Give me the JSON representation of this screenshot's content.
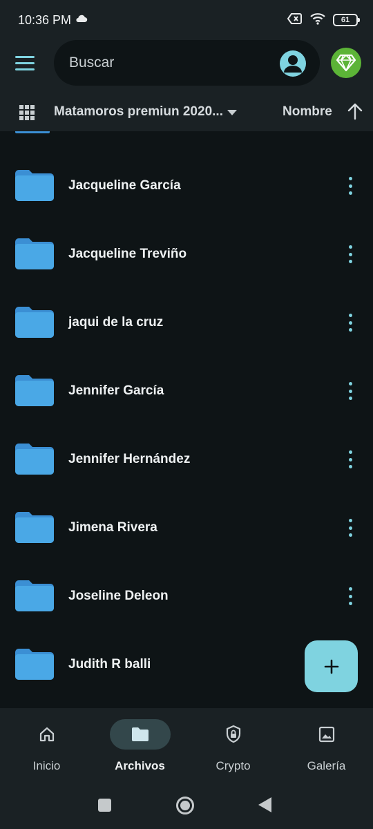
{
  "status_bar": {
    "time": "10:36 PM",
    "battery": "61"
  },
  "header": {
    "search_placeholder": "Buscar",
    "path_label": "Matamoros premiun 2020...",
    "sort_label": "Nombre"
  },
  "folders": [
    {
      "name": "Jacqueline García"
    },
    {
      "name": "Jacqueline Treviño"
    },
    {
      "name": "jaqui de la cruz"
    },
    {
      "name": "Jennifer García"
    },
    {
      "name": "Jennifer Hernández"
    },
    {
      "name": "Jimena Rivera"
    },
    {
      "name": "Joseline Deleon"
    },
    {
      "name": "Judith R balli"
    }
  ],
  "bottom_nav": {
    "items": [
      {
        "label": "Inicio",
        "icon": "home-icon"
      },
      {
        "label": "Archivos",
        "icon": "folder-icon",
        "active": true
      },
      {
        "label": "Crypto",
        "icon": "shield-lock-icon"
      },
      {
        "label": "Galería",
        "icon": "image-icon"
      }
    ]
  },
  "colors": {
    "accent": "#7fd3e0",
    "folder": "#4aa8e6",
    "background": "#0e1416",
    "surface": "#1a2124",
    "premium": "#5cb437"
  }
}
